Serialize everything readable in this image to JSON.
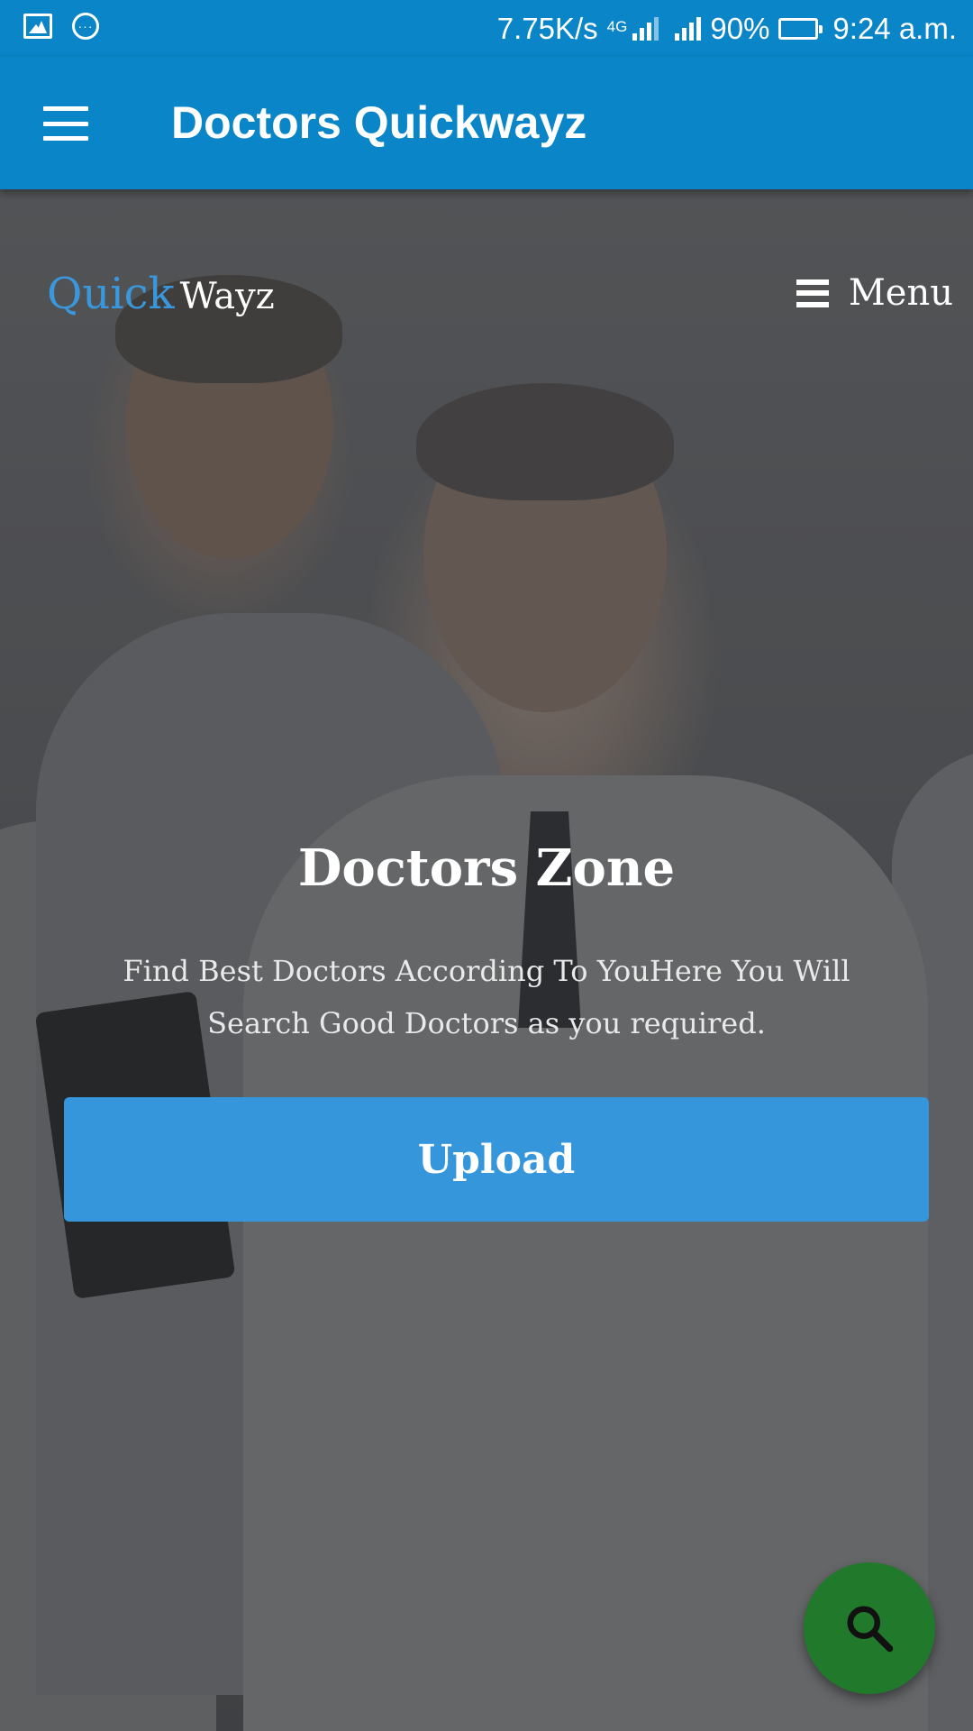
{
  "status_bar": {
    "net_speed": "7.75K/s",
    "network_type": "4G",
    "battery": "90%",
    "battery_level": 0.9,
    "time": "9:24 a.m.",
    "icons": [
      "image-icon",
      "message-icon",
      "signal-icon",
      "battery-icon"
    ]
  },
  "app_bar": {
    "title": "Doctors Quickwayz",
    "nav_icon": "hamburger-menu-icon"
  },
  "hero": {
    "logo_quick": "Quick",
    "logo_wayz": "Wayz",
    "menu_label": "Menu",
    "title": "Doctors Zone",
    "description": "Find Best Doctors According To YouHere You Will Search Good Doctors as you required.",
    "button_label": "Upload"
  },
  "fab": {
    "icon": "search-icon"
  },
  "colors": {
    "primary": "#0a85c7",
    "logo_accent": "#3a97dc",
    "button": "#3596dc",
    "fab": "#217a2b"
  }
}
